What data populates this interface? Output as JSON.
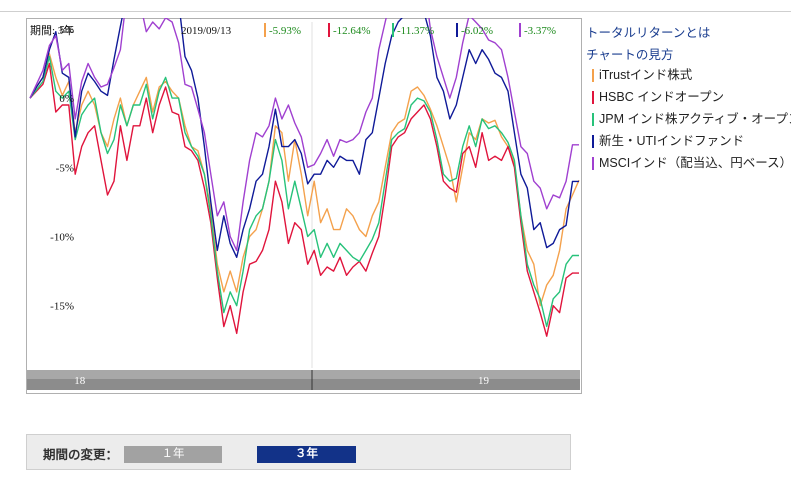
{
  "header": {
    "period_label": "期間: 3年",
    "date": "2019/09/13"
  },
  "links": {
    "total_return": "トータルリターンとは",
    "how_to_read": "チャートの見方"
  },
  "colors": {
    "itrust": "#f4a14c",
    "hsbc": "#e0143c",
    "jpm": "#27c27a",
    "shinsei": "#0f1a98",
    "msci": "#a040d0",
    "value_text": "#1c8a1c"
  },
  "period_changer": {
    "label": "期間の変更：",
    "btn_1y": "１年",
    "btn_3y": "３年",
    "selected": "３年"
  },
  "chart_data": {
    "type": "line",
    "ylim": [
      -19.5,
      5.5
    ],
    "y_ticks": [
      5,
      0,
      -5,
      -10,
      -15
    ],
    "y_tick_labels": [
      "5%",
      "0%",
      "-5%",
      "-10%",
      "-15%"
    ],
    "x_range": [
      "2017-09",
      "2019-09"
    ],
    "x_tick_labels": [
      {
        "label": "18",
        "date": "2018-01"
      },
      {
        "label": "19",
        "date": "2019-01"
      }
    ],
    "grid": "vertical line at 2019-01",
    "legend": "right",
    "series": [
      {
        "name": "iTrustインド株式",
        "color": "#f4a14c",
        "value_label": "-5.93%",
        "values": [
          0,
          0.8,
          1.5,
          3.2,
          1.5,
          0.2,
          1.2,
          -2.5,
          -0.5,
          0.5,
          -0.5,
          -2.5,
          -3.5,
          -1.5,
          0,
          -2,
          -0.5,
          0.5,
          1.5,
          -1,
          0.8,
          1.2,
          0.5,
          0,
          -2,
          -3.5,
          -3.8,
          -5.5,
          -8,
          -12,
          -14,
          -12.5,
          -14,
          -11.5,
          -10,
          -9.5,
          -8,
          -6,
          -2,
          -2.5,
          -6,
          -3,
          -5.5,
          -8.5,
          -6,
          -9,
          -8,
          -9.5,
          -9.5,
          -8,
          -8.5,
          -9.5,
          -10,
          -8.5,
          -7.5,
          -5,
          -2.5,
          -1.8,
          -1.5,
          0.5,
          0.8,
          0.2,
          -0.8,
          -2,
          -3.5,
          -5,
          -7.5,
          -5,
          -2.5,
          -3,
          -1.5,
          -1.8,
          -1.6,
          -2.8,
          -3.5,
          -4.8,
          -8.5,
          -11,
          -12,
          -15,
          -13.5,
          -12.8,
          -11,
          -8,
          -7,
          -5.93
        ]
      },
      {
        "name": "HSBC インドオープン",
        "color": "#e0143c",
        "value_label": "-12.64%",
        "values": [
          0,
          0.5,
          1,
          2.5,
          -1,
          -0.5,
          -0.5,
          -5.5,
          -3.5,
          -2.5,
          -2,
          -4.5,
          -7,
          -6,
          -2,
          -4.5,
          -2,
          -2,
          0,
          -2.5,
          -0.5,
          0.8,
          -1,
          -1.2,
          -3.5,
          -3.8,
          -4.5,
          -6.5,
          -9,
          -13,
          -16.5,
          -15,
          -17,
          -14,
          -12,
          -11.8,
          -11,
          -9.5,
          -6,
          -7.5,
          -10.5,
          -9,
          -9.5,
          -12,
          -11,
          -12.8,
          -12.2,
          -12.5,
          -11.5,
          -12.8,
          -12.2,
          -11.8,
          -12.5,
          -11.2,
          -10,
          -7,
          -3.5,
          -2.8,
          -2.5,
          -1.5,
          -1,
          -0.5,
          -1.5,
          -3.5,
          -6,
          -6.5,
          -6.8,
          -4,
          -3.5,
          -5,
          -2.5,
          -4.5,
          -4.2,
          -4.5,
          -3.5,
          -5,
          -9,
          -12.5,
          -14,
          -15.5,
          -17.2,
          -15,
          -15.5,
          -13,
          -12.64,
          -12.64
        ]
      },
      {
        "name": "JPM インド株アクティブ・オープン",
        "color": "#27c27a",
        "value_label": "-11.37%",
        "values": [
          0,
          0.6,
          1.2,
          3,
          0.5,
          0,
          0.5,
          -3,
          -1.2,
          -0.5,
          0,
          -2.5,
          -4,
          -3,
          -0.5,
          -2,
          -0.5,
          -0.5,
          1,
          -1.5,
          0.5,
          1.5,
          0,
          0,
          -2.5,
          -3.5,
          -4.2,
          -5.5,
          -8.5,
          -12.5,
          -15.5,
          -14,
          -15,
          -12.5,
          -9.5,
          -8.5,
          -8,
          -6,
          -3,
          -4.5,
          -8,
          -6,
          -8,
          -10,
          -9.5,
          -11.5,
          -10.5,
          -11.5,
          -10.5,
          -11,
          -11.5,
          -11.8,
          -11,
          -10.2,
          -9,
          -6,
          -3,
          -2.5,
          -2.2,
          -0.5,
          0,
          -0.2,
          -1,
          -3,
          -5.5,
          -6,
          -5.8,
          -3.5,
          -2,
          -3.5,
          -1.5,
          -2.2,
          -2,
          -2.5,
          -3.2,
          -4.5,
          -8.5,
          -12,
          -13.5,
          -14.5,
          -16.5,
          -14.5,
          -14,
          -12,
          -11.37,
          -11.37
        ]
      },
      {
        "name": "新生・UTIインドファンド",
        "color": "#0f1a98",
        "value_label": "-6.02%",
        "values": [
          0,
          0.8,
          1.5,
          3.5,
          4.8,
          1.8,
          1.5,
          -2.8,
          0.5,
          1.8,
          1.2,
          0.5,
          0.2,
          2.8,
          5.2,
          7.5,
          6.5,
          7.8,
          9,
          8,
          7.2,
          9.2,
          9.2,
          7,
          3,
          2,
          0,
          -3.5,
          -7.5,
          -11,
          -8.5,
          -10.5,
          -11.5,
          -9.5,
          -8,
          -6,
          -5.5,
          -3.5,
          -0.8,
          -3.5,
          -3.5,
          -3,
          -4,
          -6.2,
          -5.5,
          -5.5,
          -4.5,
          -5,
          -4.2,
          -4.5,
          -4.5,
          -5.5,
          -3,
          -2.5,
          0,
          2.5,
          4.5,
          5.5,
          6,
          6.8,
          6.5,
          6.2,
          4.5,
          1.5,
          0.5,
          -1.5,
          -0.5,
          1.5,
          3.5,
          2.5,
          3.5,
          2.8,
          1.8,
          1.5,
          0.5,
          -2.5,
          -5.5,
          -6.5,
          -9.5,
          -9,
          -10.8,
          -10.5,
          -9.5,
          -9.2,
          -6.02,
          -6.02
        ]
      },
      {
        "name": "MSCIインド（配当込、円ベース）",
        "color": "#a040d0",
        "value_label": "-3.37%",
        "values": [
          0,
          1,
          2,
          3.8,
          4.5,
          2,
          2.5,
          -1.5,
          1.2,
          2.5,
          1.5,
          0.8,
          1,
          2.2,
          3.5,
          7.5,
          6,
          7,
          4.8,
          5.5,
          5,
          5.8,
          5.5,
          4,
          1,
          0.8,
          -0.8,
          -2.5,
          -5.5,
          -8.5,
          -7.5,
          -10,
          -11,
          -7.5,
          -4.5,
          -2.5,
          -2.8,
          -2,
          0,
          -1.5,
          -0.5,
          -1.8,
          -2.8,
          -5,
          -4.8,
          -4,
          -3,
          -4.2,
          -3,
          -3.2,
          -3,
          -2.5,
          -1,
          0,
          3.5,
          5.5,
          7.5,
          8,
          8.5,
          9,
          9.5,
          8.5,
          5,
          3,
          1.5,
          0,
          1.5,
          4,
          6,
          5.5,
          5,
          4.2,
          4,
          3.5,
          1.5,
          -1,
          -3.5,
          -4,
          -6,
          -6.5,
          -8,
          -7,
          -7.2,
          -6,
          -3.37,
          -3.37
        ]
      }
    ]
  }
}
